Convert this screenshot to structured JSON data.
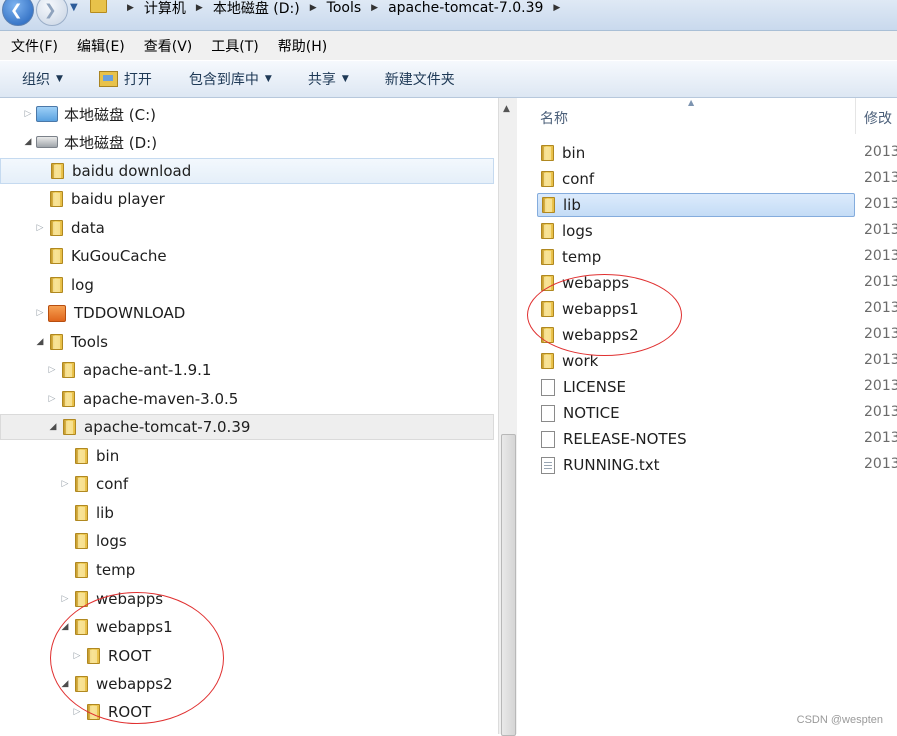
{
  "address_bar": {
    "crumbs": [
      "计算机",
      "本地磁盘 (D:)",
      "Tools",
      "apache-tomcat-7.0.39"
    ]
  },
  "menu": [
    "文件(F)",
    "编辑(E)",
    "查看(V)",
    "工具(T)",
    "帮助(H)"
  ],
  "toolbar": {
    "organize": "组织",
    "open": "打开",
    "include_in_library": "包含到库中",
    "share": "共享",
    "new_folder": "新建文件夹"
  },
  "tree": [
    {
      "label": "本地磁盘 (C:)",
      "icon": "drive-c-icon",
      "expander": "collapsed"
    },
    {
      "label": "本地磁盘 (D:)",
      "icon": "drive-icon",
      "expander": "expanded"
    },
    {
      "label": "baidu download",
      "icon": "folder-icon",
      "expander": "none",
      "state": "highlight"
    },
    {
      "label": "baidu player",
      "icon": "folder-icon",
      "expander": "none"
    },
    {
      "label": "data",
      "icon": "folder-icon",
      "expander": "collapsed"
    },
    {
      "label": "KuGouCache",
      "icon": "folder-icon",
      "expander": "none"
    },
    {
      "label": "log",
      "icon": "folder-icon",
      "expander": "none"
    },
    {
      "label": "TDDOWNLOAD",
      "icon": "tddownload-folder-icon",
      "expander": "collapsed"
    },
    {
      "label": "Tools",
      "icon": "folder-icon",
      "expander": "expanded"
    },
    {
      "label": "apache-ant-1.9.1",
      "icon": "folder-icon",
      "expander": "collapsed"
    },
    {
      "label": "apache-maven-3.0.5",
      "icon": "folder-icon",
      "expander": "collapsed"
    },
    {
      "label": "apache-tomcat-7.0.39",
      "icon": "folder-icon",
      "expander": "expanded",
      "state": "selected"
    },
    {
      "label": "bin",
      "icon": "folder-icon",
      "expander": "none"
    },
    {
      "label": "conf",
      "icon": "folder-icon",
      "expander": "collapsed"
    },
    {
      "label": "lib",
      "icon": "folder-icon",
      "expander": "none"
    },
    {
      "label": "logs",
      "icon": "folder-icon",
      "expander": "none"
    },
    {
      "label": "temp",
      "icon": "folder-icon",
      "expander": "none"
    },
    {
      "label": "webapps",
      "icon": "folder-icon",
      "expander": "collapsed"
    },
    {
      "label": "webapps1",
      "icon": "folder-icon",
      "expander": "expanded"
    },
    {
      "label": "ROOT",
      "icon": "folder-icon",
      "expander": "collapsed"
    },
    {
      "label": "webapps2",
      "icon": "folder-icon",
      "expander": "expanded"
    },
    {
      "label": "ROOT",
      "icon": "folder-icon",
      "expander": "collapsed"
    }
  ],
  "columns": {
    "name": "名称",
    "modified": "修改"
  },
  "files": [
    {
      "name": "bin",
      "type": "folder",
      "date": "2013"
    },
    {
      "name": "conf",
      "type": "folder",
      "date": "2013"
    },
    {
      "name": "lib",
      "type": "folder",
      "date": "2013",
      "selected": true
    },
    {
      "name": "logs",
      "type": "folder",
      "date": "2013"
    },
    {
      "name": "temp",
      "type": "folder",
      "date": "2013"
    },
    {
      "name": "webapps",
      "type": "folder",
      "date": "2013"
    },
    {
      "name": "webapps1",
      "type": "folder",
      "date": "2013"
    },
    {
      "name": "webapps2",
      "type": "folder",
      "date": "2013"
    },
    {
      "name": "work",
      "type": "folder",
      "date": "2013"
    },
    {
      "name": "LICENSE",
      "type": "file",
      "date": "2013"
    },
    {
      "name": "NOTICE",
      "type": "file",
      "date": "2013"
    },
    {
      "name": "RELEASE-NOTES",
      "type": "file",
      "date": "2013"
    },
    {
      "name": "RUNNING.txt",
      "type": "txt",
      "date": "2013"
    }
  ],
  "watermark": "CSDN @wespten",
  "colors": {
    "annotation": "#e03030",
    "selection": "#c4dcf6",
    "folder": "#f4d666"
  }
}
